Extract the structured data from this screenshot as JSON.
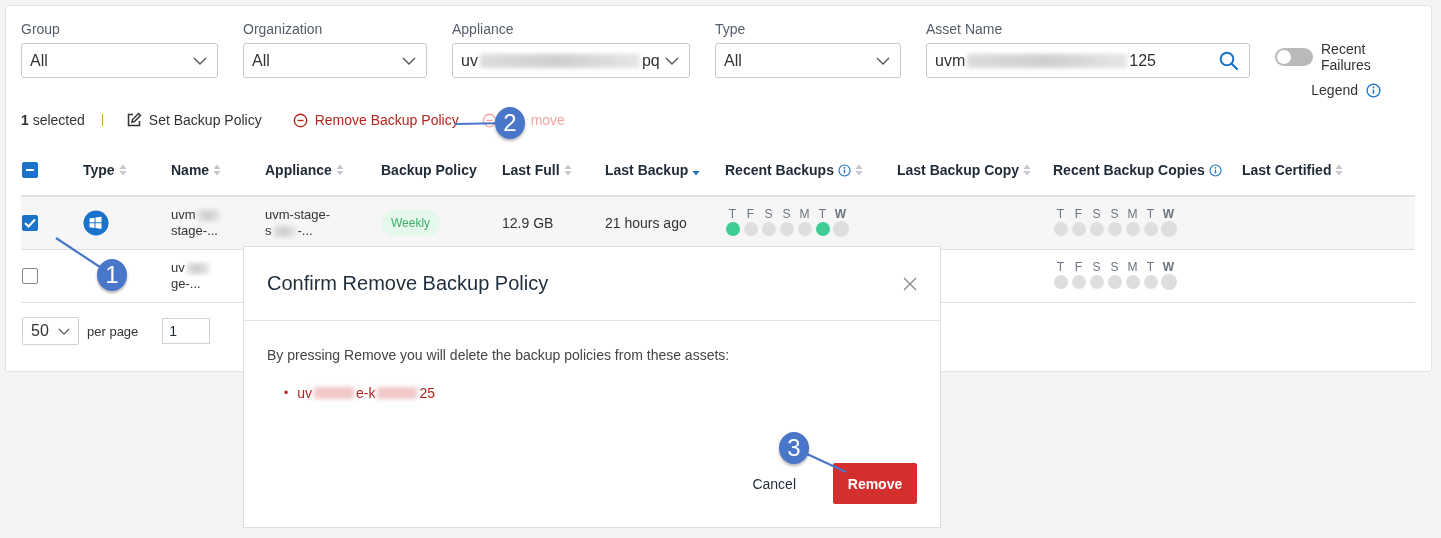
{
  "filters": [
    {
      "kind": "select",
      "label": "Group",
      "value": [
        "All"
      ]
    },
    {
      "kind": "select",
      "label": "Organization",
      "value": [
        "All"
      ]
    },
    {
      "kind": "select",
      "label": "Appliance",
      "value": [
        "uv",
        "pq"
      ]
    },
    {
      "kind": "select",
      "label": "Type",
      "value": [
        "All"
      ]
    },
    {
      "kind": "search",
      "label": "Asset Name",
      "value": [
        "uvm",
        "125"
      ]
    }
  ],
  "recent_failures": {
    "label": "Recent Failures",
    "on": false
  },
  "legend": "Legend",
  "toolbar": {
    "selected_count": "1",
    "selected_label": "selected",
    "actions": [
      {
        "kind": "edit",
        "label": "Set Backup Policy",
        "disabled": false
      },
      {
        "kind": "remove",
        "label": "Remove Backup Policy",
        "disabled": false
      },
      {
        "kind": "remove",
        "label": "move",
        "disabled": true
      }
    ]
  },
  "table": {
    "header_checkbox": {
      "indeterminate": true
    },
    "columns": [
      {
        "label": "Type",
        "sortable": true,
        "sorted_desc": false,
        "info": false
      },
      {
        "label": "Name",
        "sortable": true,
        "sorted_desc": false,
        "info": false
      },
      {
        "label": "Appliance",
        "sortable": true,
        "sorted_desc": false,
        "info": false
      },
      {
        "label": "Backup Policy",
        "sortable": false,
        "info": false
      },
      {
        "label": "Last Full",
        "sortable": true,
        "sorted_desc": false,
        "info": false
      },
      {
        "label": "Last Backup",
        "sortable": true,
        "sorted_desc": true,
        "info": false
      },
      {
        "label": "Recent Backups",
        "sortable": true,
        "sorted_desc": false,
        "info": true
      },
      {
        "label": "Last Backup Copy",
        "sortable": true,
        "sorted_desc": false,
        "info": false
      },
      {
        "label": "Recent Backup Copies",
        "sortable": false,
        "info": true
      },
      {
        "label": "Last Certified",
        "sortable": true,
        "sorted_desc": false,
        "info": false
      }
    ],
    "rows": [
      {
        "selected": true,
        "kind": "windows",
        "name": [
          {
            "parts": [
              "uvm"
            ],
            "trailing_redaction": true
          },
          {
            "parts": [
              "stage-..."
            ]
          }
        ],
        "appliance": [
          {
            "parts": [
              "uvm-stage-"
            ]
          },
          {
            "parts": [
              "s",
              "-..."
            ]
          }
        ],
        "policy": "Weekly",
        "last_full": "12.9 GB",
        "last_backup": "21 hours ago",
        "recent_backups": [
          {
            "label": "T",
            "success": true,
            "today": false
          },
          {
            "label": "F",
            "success": false,
            "today": false
          },
          {
            "label": "S",
            "success": false,
            "today": false
          },
          {
            "label": "S",
            "success": false,
            "today": false
          },
          {
            "label": "M",
            "success": false,
            "today": false
          },
          {
            "label": "T",
            "success": true,
            "today": false
          },
          {
            "label": "W",
            "success": false,
            "today": true
          }
        ],
        "recent_backup_copies": [
          {
            "label": "T",
            "success": false,
            "today": false
          },
          {
            "label": "F",
            "success": false,
            "today": false
          },
          {
            "label": "S",
            "success": false,
            "today": false
          },
          {
            "label": "S",
            "success": false,
            "today": false
          },
          {
            "label": "M",
            "success": false,
            "today": false
          },
          {
            "label": "T",
            "success": false,
            "today": false
          },
          {
            "label": "W",
            "success": false,
            "today": true
          }
        ]
      },
      {
        "selected": false,
        "name": [
          {
            "parts": [
              "uv"
            ],
            "trailing_redaction": true
          },
          {
            "parts": [
              "ge-..."
            ]
          }
        ],
        "recent_backup_copies": [
          {
            "label": "T",
            "success": false,
            "today": false
          },
          {
            "label": "F",
            "success": false,
            "today": false
          },
          {
            "label": "S",
            "success": false,
            "today": false
          },
          {
            "label": "S",
            "success": false,
            "today": false
          },
          {
            "label": "M",
            "success": false,
            "today": false
          },
          {
            "label": "T",
            "success": false,
            "today": false
          },
          {
            "label": "W",
            "success": false,
            "today": true
          }
        ]
      }
    ]
  },
  "pagination": {
    "per_page": "50",
    "per_page_label": "per page",
    "page": "1"
  },
  "dialog": {
    "title": "Confirm Remove Backup Policy",
    "message": "By pressing Remove you will delete the backup policies from these assets:",
    "bullet": "•",
    "assets": [
      [
        "uv",
        "e-k",
        "25"
      ]
    ],
    "buttons": [
      {
        "label": "Cancel",
        "kind": "secondary"
      },
      {
        "label": "Remove",
        "kind": "danger"
      }
    ]
  },
  "annotations": [
    {
      "label": "1"
    },
    {
      "label": "2"
    },
    {
      "label": "3"
    }
  ]
}
